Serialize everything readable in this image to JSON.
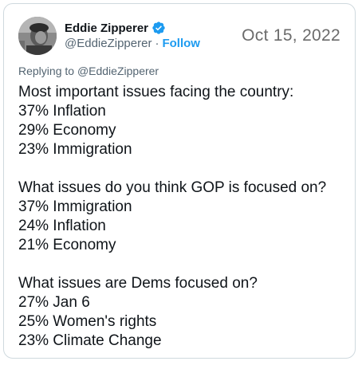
{
  "author": {
    "display_name": "Eddie Zipperer",
    "handle": "@EddieZipperer",
    "separator": "·",
    "follow_label": "Follow",
    "verified_icon": "verified-badge-icon",
    "accent_color": "#1d9bf0"
  },
  "date": "Oct 15, 2022",
  "replying": {
    "prefix": "Replying to",
    "mention": "@EddieZipperer"
  },
  "tweet": {
    "sections": [
      {
        "heading": "Most important issues facing the country:",
        "items": [
          "37% Inflation",
          "29% Economy",
          "23% Immigration"
        ]
      },
      {
        "heading": "What issues do you think GOP is focused on?",
        "items": [
          "37% Immigration",
          "24% Inflation",
          "21% Economy"
        ]
      },
      {
        "heading": "What issues are Dems focused on?",
        "items": [
          "27% Jan 6",
          "25% Women's rights",
          "23% Climate Change"
        ]
      }
    ]
  }
}
